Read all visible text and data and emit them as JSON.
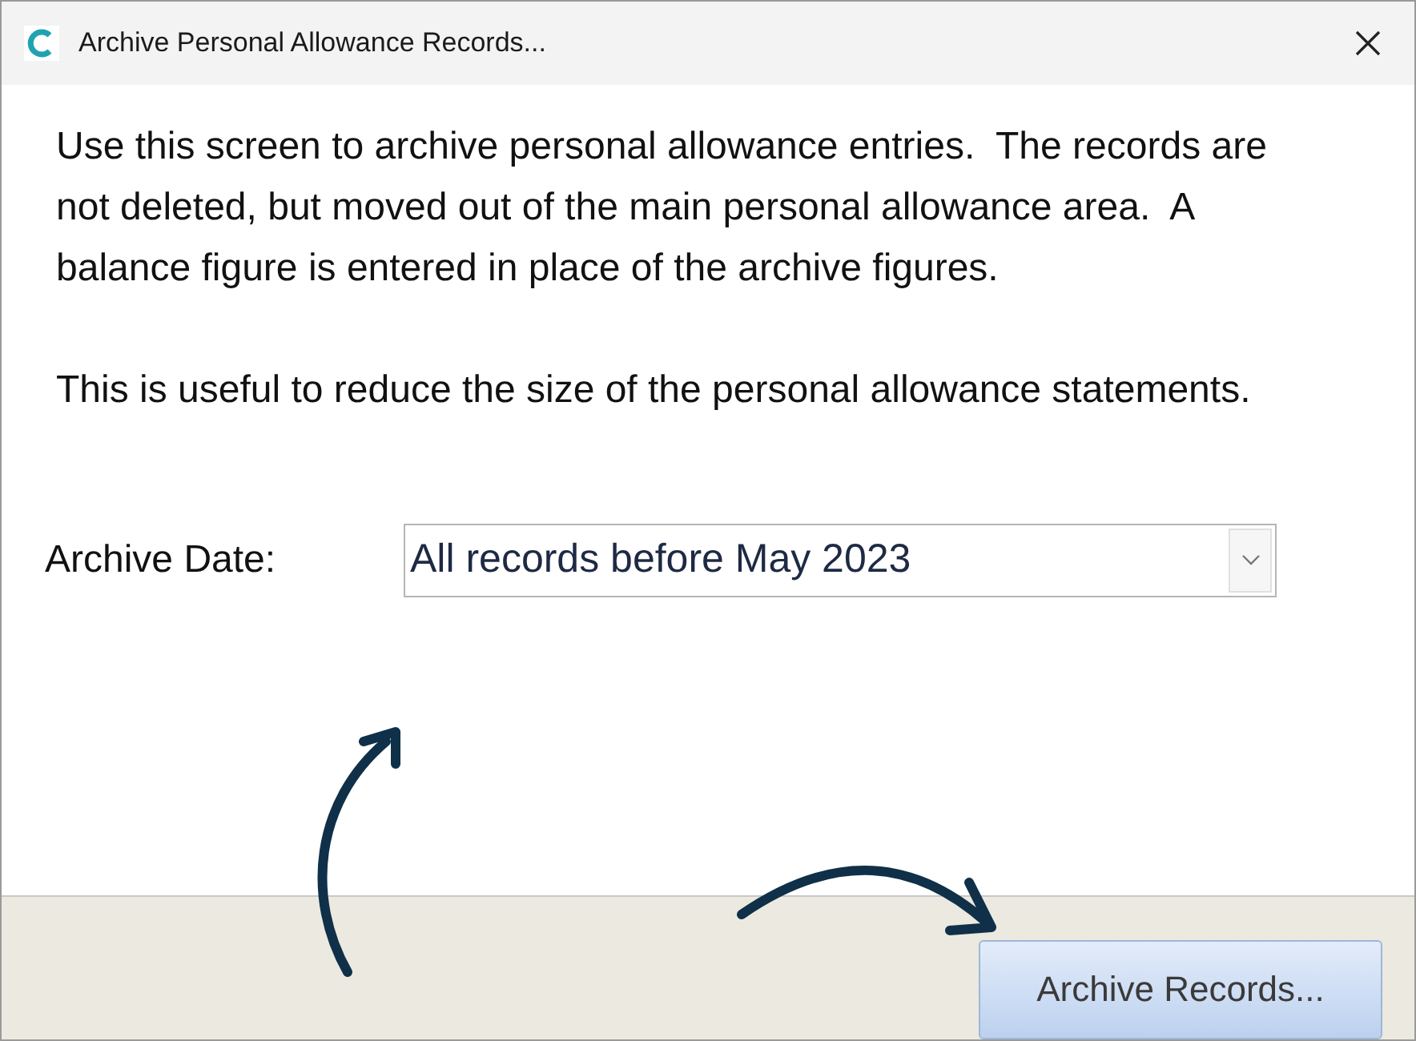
{
  "window": {
    "title": "Archive Personal Allowance Records..."
  },
  "paragraphs": [
    "Use this screen to archive personal allowance entries.  The records are not deleted, but moved out of the main personal allowance area.  A balance figure is entered in place of the archive figures.",
    "This is useful to reduce the size of the personal allowance statements."
  ],
  "archive_date": {
    "label": "Archive Date:",
    "value": "All records before May 2023"
  },
  "buttons": [
    "Archive Records..."
  ]
}
